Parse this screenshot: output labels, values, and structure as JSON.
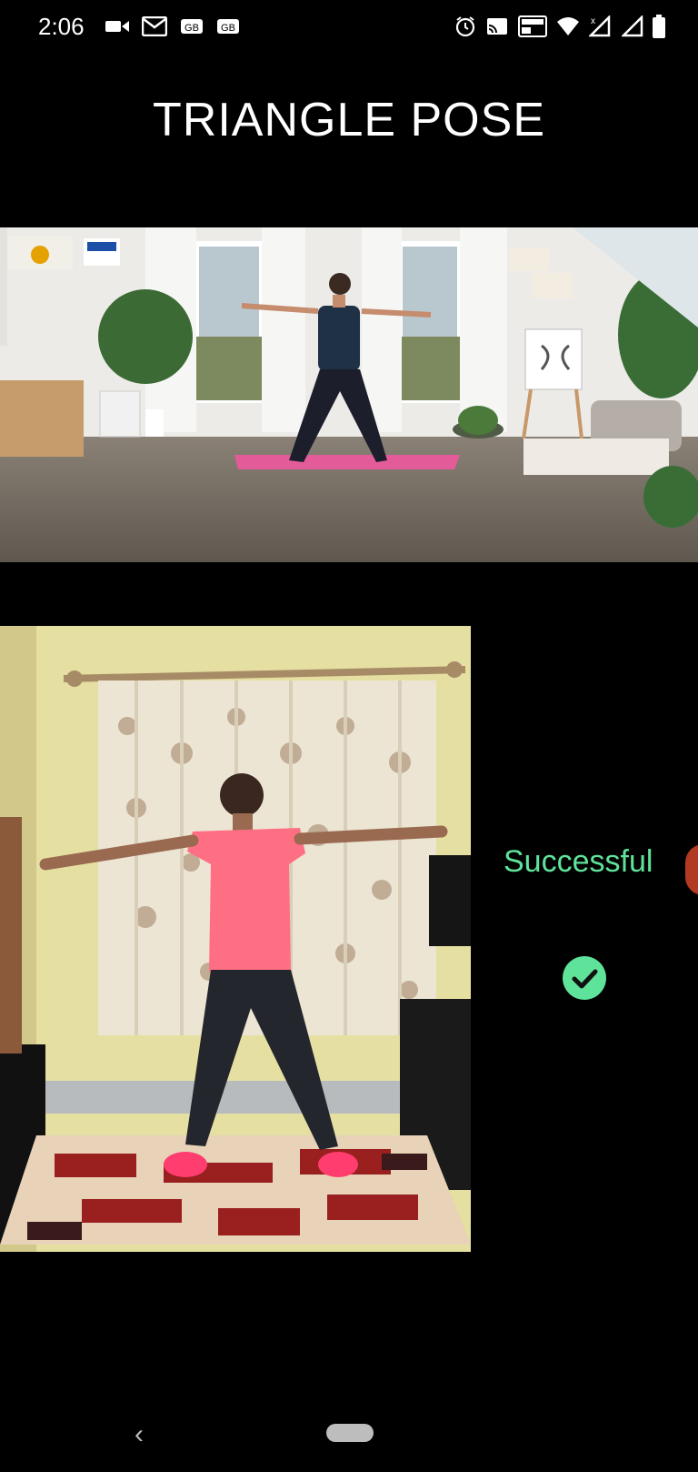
{
  "status_bar": {
    "time": "2:06",
    "left_icons": [
      "video-camera-icon",
      "gmail-icon",
      "gmail-icon",
      "gmail-icon"
    ],
    "right_icons": [
      "alarm-icon",
      "cast-icon",
      "volte-icon",
      "wifi-icon",
      "signal-icon",
      "signal-icon",
      "battery-icon"
    ]
  },
  "header": {
    "title": "TRIANGLE POSE"
  },
  "reference_video": {
    "description_visible": false
  },
  "result": {
    "text": "Successful",
    "color": "#5fe39a",
    "icon": "check-circle-icon"
  },
  "navigation": {
    "back_icon": "back-chevron-icon",
    "home_icon": "home-pill-icon"
  }
}
